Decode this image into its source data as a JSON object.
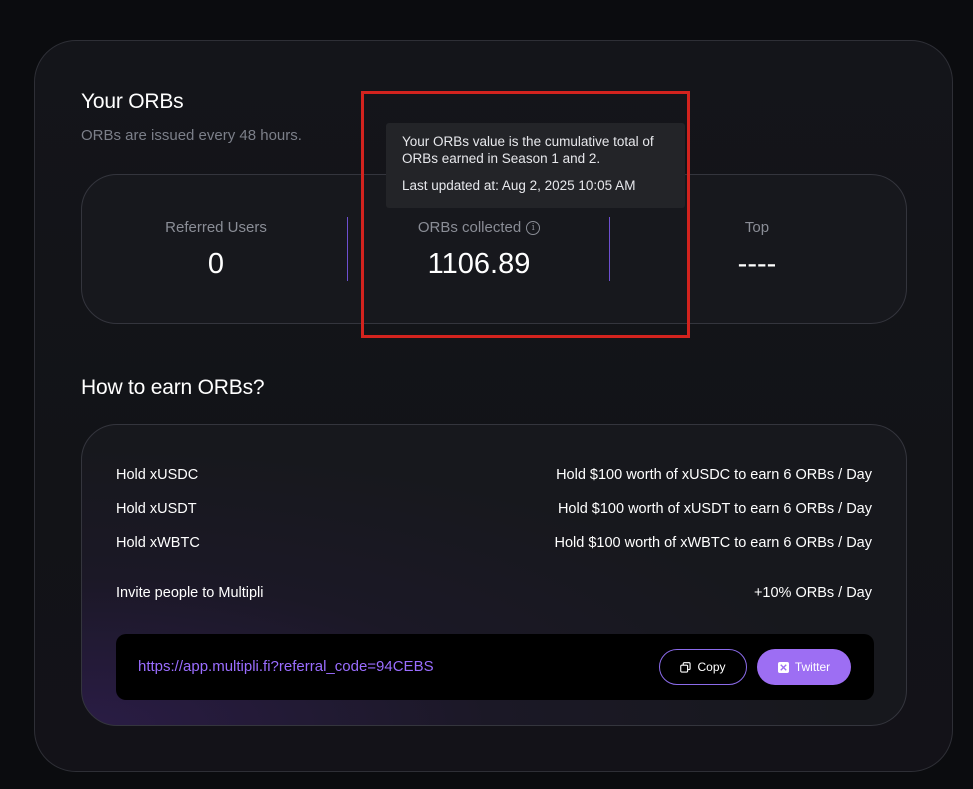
{
  "orbs_section": {
    "title": "Your ORBs",
    "subtitle": "ORBs are issued every 48 hours."
  },
  "stats": {
    "referred_users": {
      "label": "Referred Users",
      "value": "0"
    },
    "orbs_collected": {
      "label": "ORBs collected",
      "value": "1106.89",
      "info_icon": "info-icon"
    },
    "top": {
      "label": "Top",
      "value": "----"
    }
  },
  "tooltip": {
    "line1": "Your ORBs value is the cumulative total of ORBs earned in Season 1 and 2.",
    "line2": "Last updated at: Aug 2, 2025 10:05 AM"
  },
  "earn_section": {
    "title": "How to earn ORBs?",
    "rows": [
      {
        "left": "Hold xUSDC",
        "right": "Hold $100 worth of xUSDC to earn 6 ORBs / Day"
      },
      {
        "left": "Hold xUSDT",
        "right": "Hold $100 worth of xUSDT to earn 6 ORBs / Day"
      },
      {
        "left": "Hold xWBTC",
        "right": "Hold $100 worth of xWBTC to earn 6 ORBs / Day"
      },
      {
        "left": "Invite people to Multipli",
        "right": "+10% ORBs / Day"
      }
    ],
    "referral_link": "https://app.multipli.fi?referral_code=94CEBS",
    "copy_label": "Copy",
    "copy_icon": "copy-icon",
    "twitter_label": "Twitter",
    "twitter_icon": "x-logo-icon"
  },
  "colors": {
    "accent_purple": "#9d6ef3",
    "link_purple": "#9a6dff",
    "highlight_red": "#d3231e",
    "background": "#0b0c0f"
  }
}
